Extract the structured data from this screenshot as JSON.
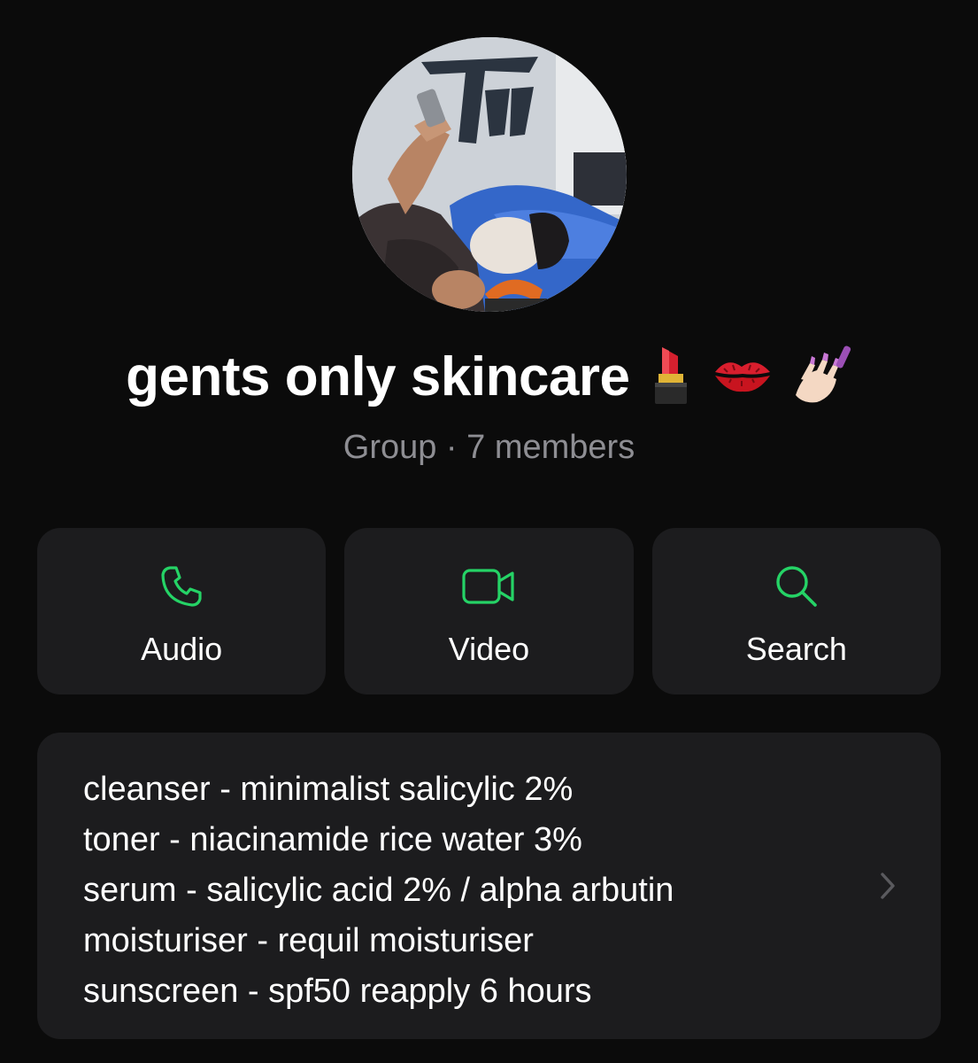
{
  "profile": {
    "name": "gents only skincare",
    "emojis": [
      "lipstick",
      "kiss-mark",
      "nail-polish"
    ],
    "subtitle": "Group · 7 members"
  },
  "actions": [
    {
      "label": "Audio",
      "icon": "phone-icon"
    },
    {
      "label": "Video",
      "icon": "video-camera-icon"
    },
    {
      "label": "Search",
      "icon": "search-icon"
    }
  ],
  "description": {
    "lines": [
      "cleanser - minimalist salicylic 2%",
      "toner - niacinamide rice water 3%",
      "serum - salicylic acid 2% / alpha arbutin",
      "moisturiser - requil moisturiser",
      "sunscreen - spf50 reapply 6 hours"
    ],
    "chevron_icon": "chevron-right-icon"
  },
  "colors": {
    "background": "#0b0b0b",
    "card": "#1c1c1e",
    "accent": "#25d366",
    "secondary_text": "#8e8e93"
  }
}
